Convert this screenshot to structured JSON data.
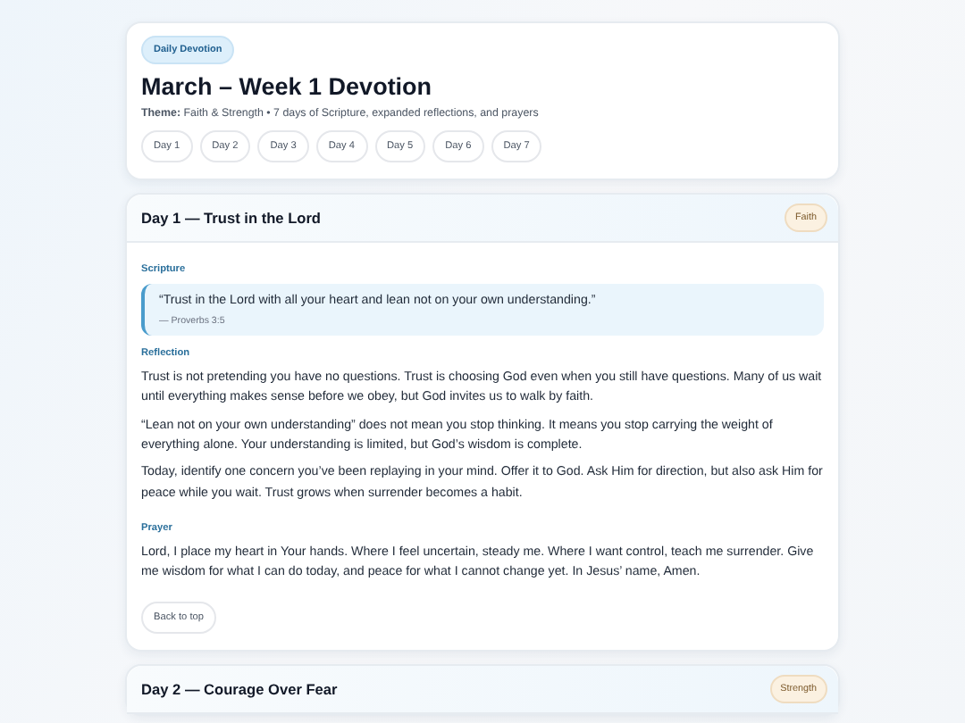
{
  "header": {
    "badge": "Daily Devotion",
    "title": "March – Week 1 Devotion",
    "theme": "**Theme:** Faith & Strength • 7 days of Scripture, expanded reflections, and prayers",
    "day_links": [
      "Day 1",
      "Day 2",
      "Day 3",
      "Day 4",
      "Day 5",
      "Day 6",
      "Day 7"
    ]
  },
  "days": [
    {
      "title": "Day 1 — Trust in the Lord",
      "tag": "Faith",
      "sections": [
        {
          "kind": "scripture",
          "heading": "Scripture",
          "quote": "“Trust in the Lord with all your heart and lean not on your own understanding.”",
          "reference": "— Proverbs 3:5"
        },
        {
          "kind": "text",
          "heading": "Reflection",
          "paragraphs": [
            "Trust is not pretending you have no questions. Trust is choosing God even when you still have questions. Many of us wait until everything makes sense before we obey, but God invites us to walk by faith.",
            "“Lean not on your own understanding” does not mean you stop thinking. It means you stop carrying the weight of everything alone. Your understanding is limited, but God’s wisdom is complete.",
            "Today, identify one concern you’ve been replaying in your mind. Offer it to God. Ask Him for direction, but also ask Him for peace while you wait. Trust grows when surrender becomes a habit."
          ]
        },
        {
          "kind": "text",
          "heading": "Prayer",
          "paragraphs": [
            "Lord, I place my heart in Your hands. Where I feel uncertain, steady me. Where I want control, teach me surrender. Give me wisdom for what I can do today, and peace for what I cannot change yet. In Jesus’ name, Amen."
          ]
        }
      ],
      "back_link": "Back to top"
    },
    {
      "title": "Day 2 — Courage Over Fear",
      "tag": "Strength"
    }
  ]
}
